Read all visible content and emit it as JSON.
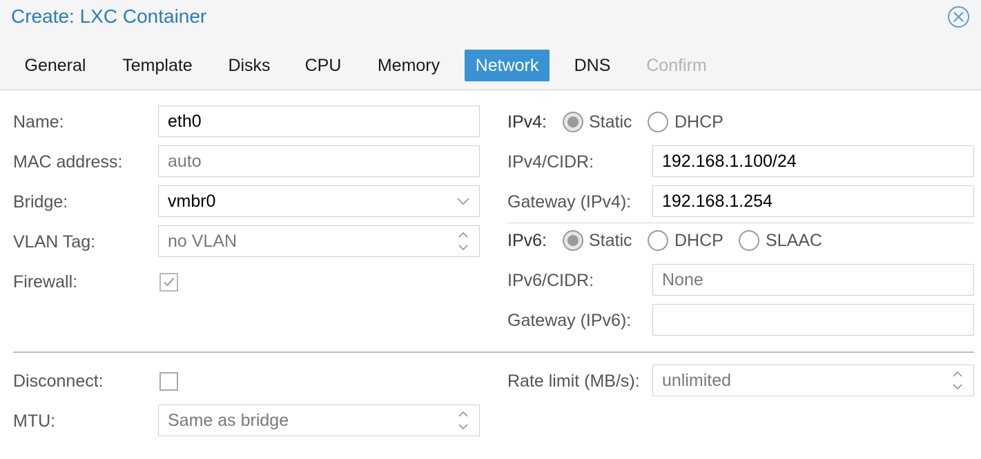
{
  "dialog": {
    "title": "Create: LXC Container",
    "close_icon": "close-circle-icon"
  },
  "tabs": [
    {
      "label": "General",
      "state": "normal"
    },
    {
      "label": "Template",
      "state": "normal"
    },
    {
      "label": "Disks",
      "state": "normal"
    },
    {
      "label": "CPU",
      "state": "normal"
    },
    {
      "label": "Memory",
      "state": "normal"
    },
    {
      "label": "Network",
      "state": "active"
    },
    {
      "label": "DNS",
      "state": "normal"
    },
    {
      "label": "Confirm",
      "state": "disabled"
    }
  ],
  "left": {
    "name": {
      "label": "Name:",
      "value": "eth0"
    },
    "mac": {
      "label": "MAC address:",
      "placeholder": "auto"
    },
    "bridge": {
      "label": "Bridge:",
      "value": "vmbr0"
    },
    "vlan": {
      "label": "VLAN Tag:",
      "placeholder": "no VLAN"
    },
    "firewall": {
      "label": "Firewall:",
      "checked": true
    }
  },
  "right": {
    "ipv4": {
      "label": "IPv4:",
      "options": [
        "Static",
        "DHCP"
      ],
      "selected": "Static"
    },
    "ipv4_cidr": {
      "label": "IPv4/CIDR:",
      "value": "192.168.1.100/24"
    },
    "gateway4": {
      "label": "Gateway (IPv4):",
      "value": "192.168.1.254"
    },
    "ipv6": {
      "label": "IPv6:",
      "options": [
        "Static",
        "DHCP",
        "SLAAC"
      ],
      "selected": "Static"
    },
    "ipv6_cidr": {
      "label": "IPv6/CIDR:",
      "placeholder": "None"
    },
    "gateway6": {
      "label": "Gateway (IPv6):",
      "value": ""
    }
  },
  "advanced": {
    "disconnect": {
      "label": "Disconnect:",
      "checked": false
    },
    "mtu": {
      "label": "MTU:",
      "placeholder": "Same as bridge"
    },
    "rate": {
      "label": "Rate limit (MB/s):",
      "placeholder": "unlimited"
    }
  },
  "colors": {
    "accent": "#3892d4",
    "title": "#2a7cc0",
    "header_bg": "#f5f5f5"
  }
}
